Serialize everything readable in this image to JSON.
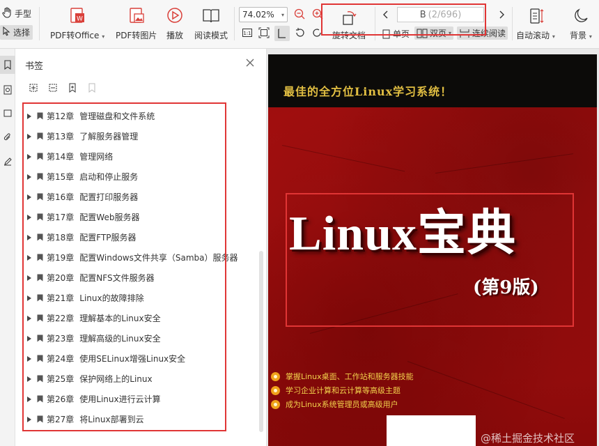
{
  "toolbar": {
    "hand_tool": "手型",
    "select_tool": "选择",
    "pdf_to_office": "PDF转Office",
    "pdf_to_image": "PDF转图片",
    "play": "播放",
    "read_mode": "阅读模式",
    "zoom": "74.02%",
    "rotate_doc": "旋转文档",
    "page_current": "B",
    "page_total": "(2/696)",
    "single_page": "单页",
    "double_page": "双页",
    "continuous_read": "连续阅读",
    "auto_scroll": "自动滚动",
    "background": "背景"
  },
  "panel": {
    "title": "书签",
    "items": [
      {
        "chapter": "第12章",
        "title": "管理磁盘和文件系统"
      },
      {
        "chapter": "第13章",
        "title": "了解服务器管理"
      },
      {
        "chapter": "第14章",
        "title": "管理网络"
      },
      {
        "chapter": "第15章",
        "title": "启动和停止服务"
      },
      {
        "chapter": "第16章",
        "title": "配置打印服务器"
      },
      {
        "chapter": "第17章",
        "title": "配置Web服务器"
      },
      {
        "chapter": "第18章",
        "title": "配置FTP服务器"
      },
      {
        "chapter": "第19章",
        "title": "配置Windows文件共享（Samba）服务器"
      },
      {
        "chapter": "第20章",
        "title": "配置NFS文件服务器"
      },
      {
        "chapter": "第21章",
        "title": "Linux的故障排除"
      },
      {
        "chapter": "第22章",
        "title": "理解基本的Linux安全"
      },
      {
        "chapter": "第23章",
        "title": "理解高级的Linux安全"
      },
      {
        "chapter": "第24章",
        "title": "使用SELinux增强Linux安全"
      },
      {
        "chapter": "第25章",
        "title": "保护网络上的Linux"
      },
      {
        "chapter": "第26章",
        "title": "使用Linux进行云计算"
      },
      {
        "chapter": "第27章",
        "title": "将Linux部署到云"
      }
    ]
  },
  "cover": {
    "slogan": "最佳的全方位Linux学习系统！",
    "title": "Linux宝典",
    "edition": "(第9版)",
    "features": [
      "掌握Linux桌面、工作站和服务器技能",
      "学习企业计算和云计算等高级主题",
      "成为Linux系统管理员或高级用户"
    ]
  },
  "watermark": "@稀土掘金技术社区",
  "colors": {
    "highlight_box": "#e03535",
    "cover_red": "#a51010",
    "slogan_gold": "#e2bf42",
    "toolbar_bg": "#f7f7f7"
  }
}
